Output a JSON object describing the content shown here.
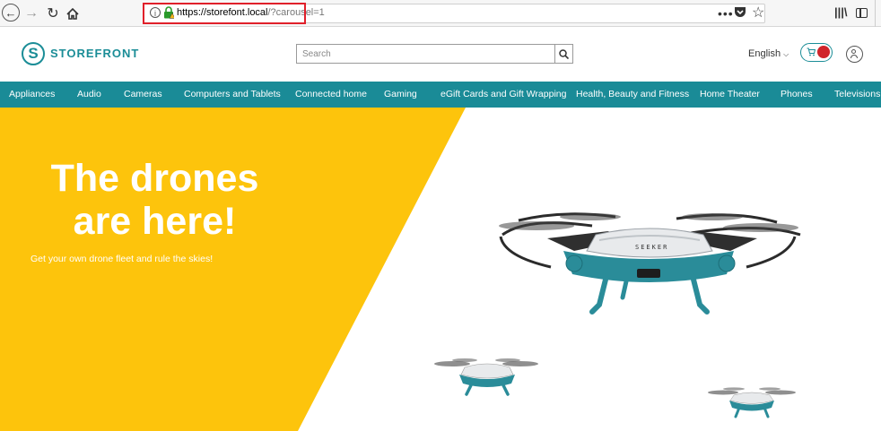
{
  "browser": {
    "url_host": "https://storefont.local",
    "url_path": "/?carousel=1",
    "menu_dots": "•••"
  },
  "store": {
    "brand": "STOREFRONT",
    "logo_letter": "S",
    "search_placeholder": "Search",
    "language": "English"
  },
  "categories": [
    "Appliances",
    "Audio",
    "Cameras",
    "Computers and Tablets",
    "Connected home",
    "Gaming",
    "eGift Cards and Gift Wrapping",
    "Health, Beauty and Fitness",
    "Home Theater",
    "Phones",
    "Televisions"
  ],
  "hero": {
    "title_line1": "The drones",
    "title_line2": "are here!",
    "subtitle": "Get your own drone fleet and rule the skies!",
    "drone_brand": "SEEKER"
  },
  "colors": {
    "accent": "#1a8b97",
    "hero_yellow": "#fdc40c",
    "cart_badge": "#d0252b",
    "url_highlight": "#e0202a"
  }
}
